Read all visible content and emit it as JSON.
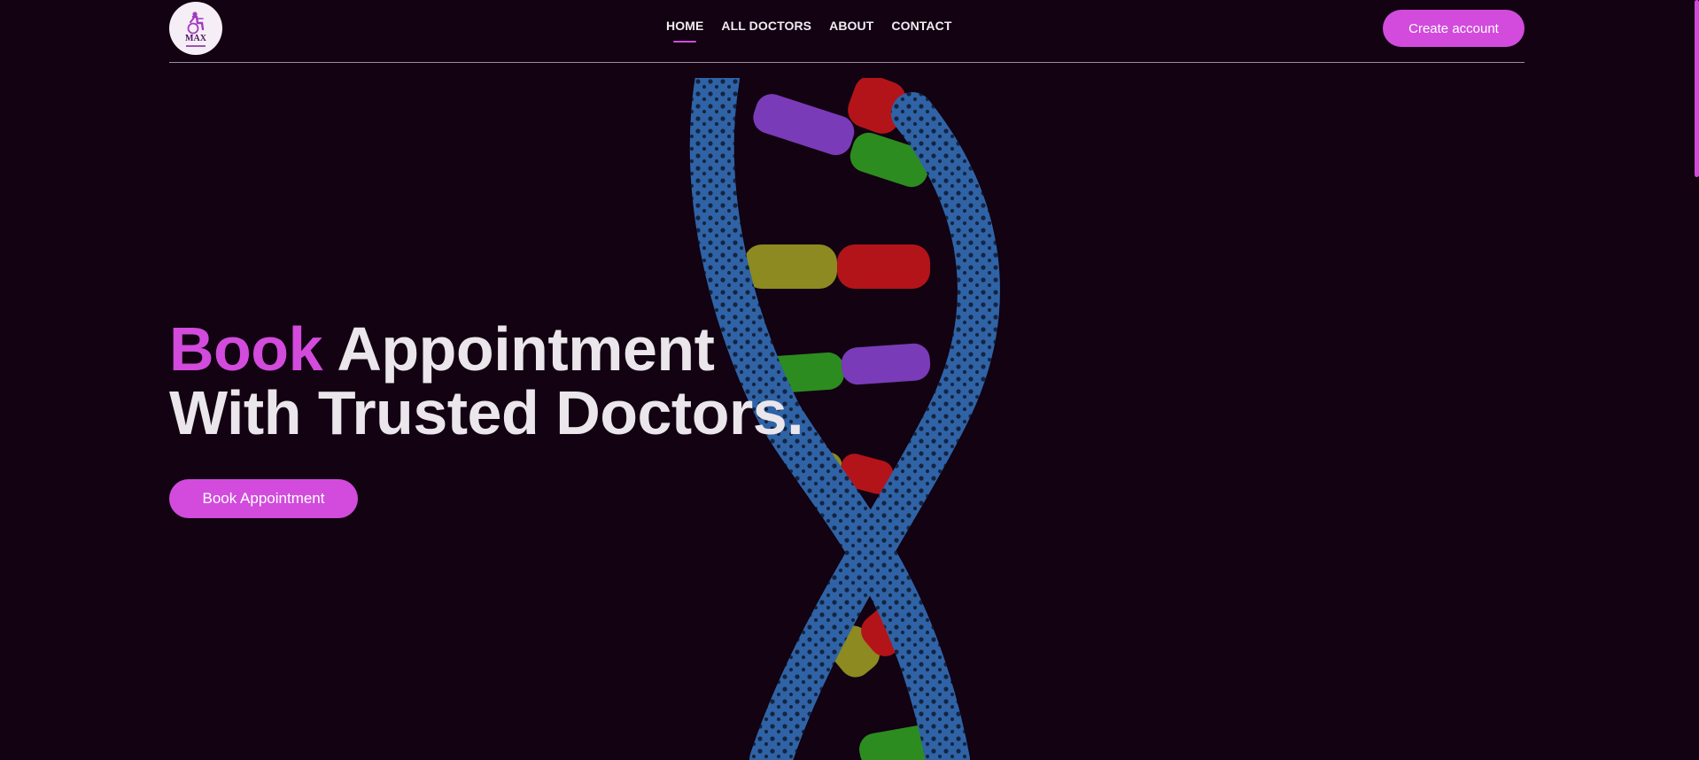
{
  "header": {
    "logo_text": "MAX",
    "nav": [
      {
        "label": "HOME",
        "active": true
      },
      {
        "label": "ALL DOCTORS",
        "active": false
      },
      {
        "label": "ABOUT",
        "active": false
      },
      {
        "label": "CONTACT",
        "active": false
      }
    ],
    "create_account_label": "Create account"
  },
  "hero": {
    "title_accent": "Book",
    "title_rest": "Appointment",
    "title_line2": "With Trusted Doctors.",
    "cta_label": "Book Appointment"
  },
  "colors": {
    "background": "#120212",
    "accent": "#d24bdc",
    "text": "#ebe6eb",
    "dna_backbone": "#2f63a6",
    "dna_purple": "#7a3bb8",
    "dna_green": "#2d8c1f",
    "dna_red": "#b3141a",
    "dna_yellow": "#8c8a20"
  },
  "icons": {
    "logo": "wheelchair-doctor-logo-icon",
    "artwork": "dna-helix-illustration"
  }
}
